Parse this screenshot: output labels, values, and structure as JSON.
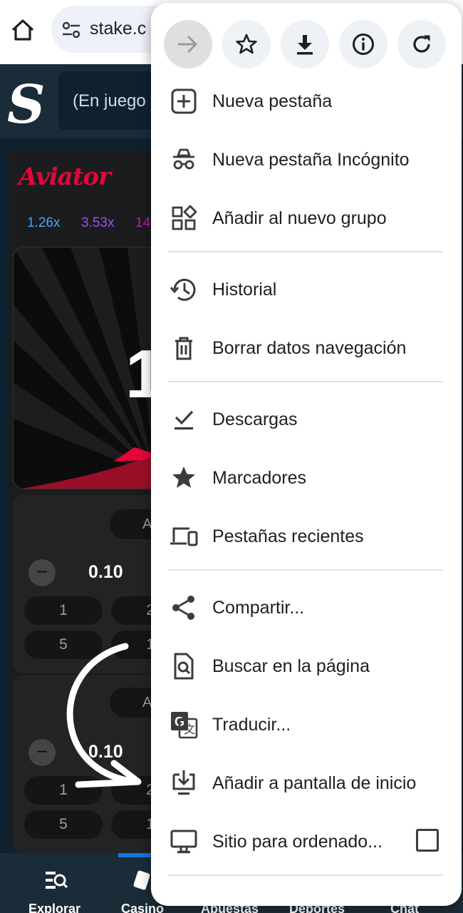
{
  "browser": {
    "url": "stake.c",
    "toolbar": [
      {
        "name": "forward-icon",
        "disabled": true
      },
      {
        "name": "star-icon",
        "disabled": false
      },
      {
        "name": "download-icon",
        "disabled": false
      },
      {
        "name": "info-icon",
        "disabled": false
      },
      {
        "name": "reload-icon",
        "disabled": false
      }
    ]
  },
  "stake": {
    "logo": "S",
    "search_text": "(En juego"
  },
  "game": {
    "title": "Aviator",
    "multipliers": [
      {
        "value": "1.26x",
        "color": "#4b9ff2"
      },
      {
        "value": "3.53x",
        "color": "#9c4ff2"
      },
      {
        "value": "14",
        "color": "#c017b4"
      }
    ],
    "big_number": "1",
    "panel1": {
      "amount": "0.10",
      "auto_label": "A",
      "chips": [
        "1",
        "2",
        "5",
        "1"
      ]
    },
    "panel2": {
      "amount": "0.10",
      "auto_label": "A",
      "chips": [
        "1",
        "2",
        "5",
        "1"
      ]
    }
  },
  "bottom_nav": [
    "Explorar",
    "Casino",
    "Apuestas",
    "Deportes",
    "Chat"
  ],
  "menu": {
    "sections": [
      [
        {
          "label": "Nueva pestaña",
          "icon": "new-tab-icon"
        },
        {
          "label": "Nueva pestaña Incógnito",
          "icon": "incognito-icon"
        },
        {
          "label": "Añadir al nuevo grupo",
          "icon": "tab-group-icon"
        }
      ],
      [
        {
          "label": "Historial",
          "icon": "history-icon"
        },
        {
          "label": "Borrar datos navegación",
          "icon": "trash-icon"
        }
      ],
      [
        {
          "label": "Descargas",
          "icon": "downloads-icon"
        },
        {
          "label": "Marcadores",
          "icon": "bookmarks-star-icon"
        },
        {
          "label": "Pestañas recientes",
          "icon": "recent-tabs-icon"
        }
      ],
      [
        {
          "label": "Compartir...",
          "icon": "share-icon"
        },
        {
          "label": "Buscar en la página",
          "icon": "find-in-page-icon"
        },
        {
          "label": "Traducir...",
          "icon": "translate-icon"
        },
        {
          "label": "Añadir a pantalla de inicio",
          "icon": "add-to-home-icon"
        },
        {
          "label": "Sitio para ordenado...",
          "icon": "desktop-site-icon",
          "checked": false
        }
      ]
    ]
  }
}
